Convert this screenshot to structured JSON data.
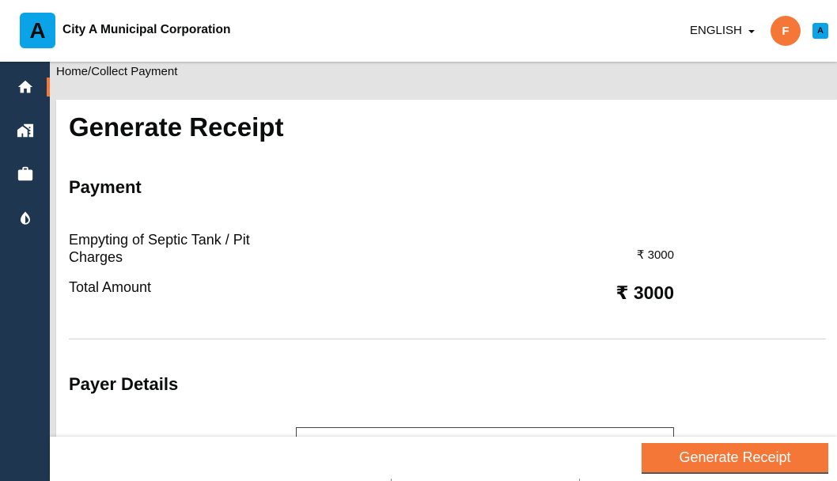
{
  "header": {
    "logo_letter": "A",
    "city_name": "City A Municipal Corporation",
    "language": "ENGLISH",
    "user_initial": "F",
    "mini_logo_letter": "A"
  },
  "sidebar": {
    "items": [
      {
        "icon": "home-icon"
      },
      {
        "icon": "buildings-icon"
      },
      {
        "icon": "briefcase-icon"
      },
      {
        "icon": "water-drop-icon"
      }
    ],
    "accent_color": "#f47738"
  },
  "breadcrumb": {
    "home": "Home",
    "separator": "/",
    "current": "Collect Payment"
  },
  "page": {
    "title": "Generate Receipt"
  },
  "payment": {
    "section_title": "Payment",
    "line_items": [
      {
        "label": "Empyting of Septic Tank / Pit Charges",
        "amount": "₹ 3000"
      }
    ],
    "total_label": "Total Amount",
    "total_amount": "₹ 3000"
  },
  "payer": {
    "section_title": "Payer Details"
  },
  "actions": {
    "submit_label": "Generate Receipt"
  },
  "colors": {
    "primary": "#f47738",
    "sidebar": "#1f3650",
    "brand": "#0aa3e8"
  }
}
